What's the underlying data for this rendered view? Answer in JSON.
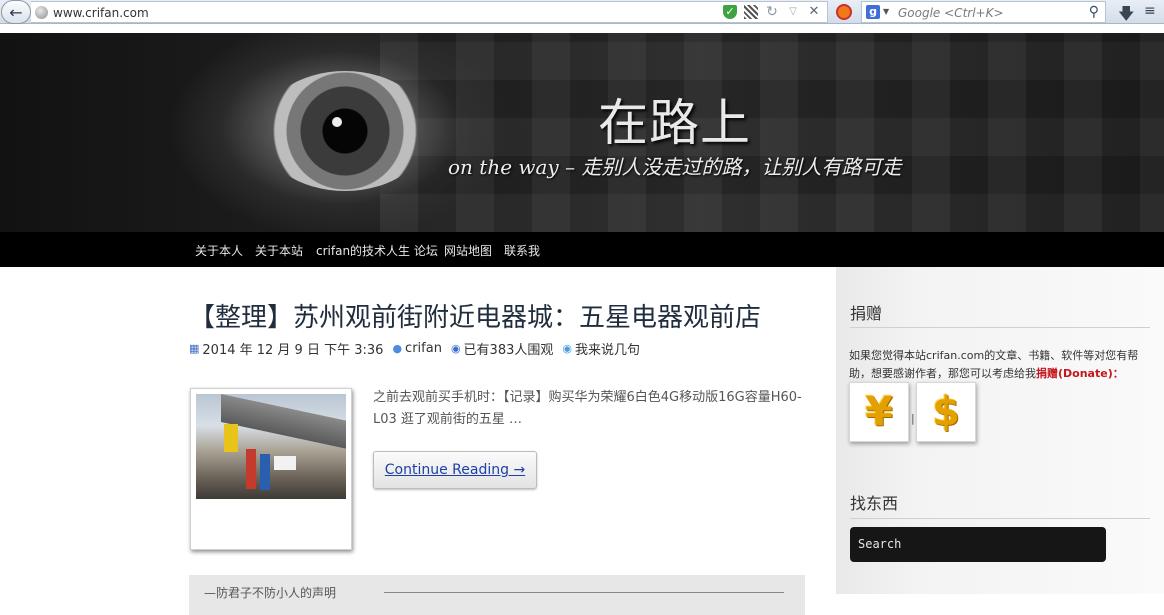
{
  "browser": {
    "url": "www.crifan.com",
    "search_placeholder": "Google <Ctrl+K>",
    "search_engine_letter": "g"
  },
  "site": {
    "title": "在路上",
    "subtitle": "on the way – 走别人没走过的路，让别人有路可走"
  },
  "nav": {
    "items": [
      "关于本人",
      "关于本站",
      "crifan的技术人生 论坛",
      "网站地图",
      "联系我"
    ]
  },
  "post": {
    "title": "【整理】苏州观前街附近电器城：五星电器观前店",
    "date": "2014 年 12 月 9 日 下午 3:36",
    "author": "crifan",
    "views": "已有383人围观",
    "comment": "我来说几句",
    "excerpt": "之前去观前买手机时：【记录】购买华为荣耀6白色4G移动版16G容量H60-L03 逛了观前街的五星 …",
    "continue_label": "Continue Reading →",
    "declaration": "—防君子不防小人的声明"
  },
  "sidebar": {
    "donate_heading": "捐赠",
    "donate_text": "如果您觉得本站crifan.com的文章、书籍、软件等对您有帮助，想要感谢作者，那您可以考虑给我",
    "donate_strong": "捐赠(Donate)：",
    "coin_yuan": "¥",
    "coin_dollar": "$",
    "coin_separator": "|",
    "search_heading": "找东西",
    "search_label": "Search"
  }
}
